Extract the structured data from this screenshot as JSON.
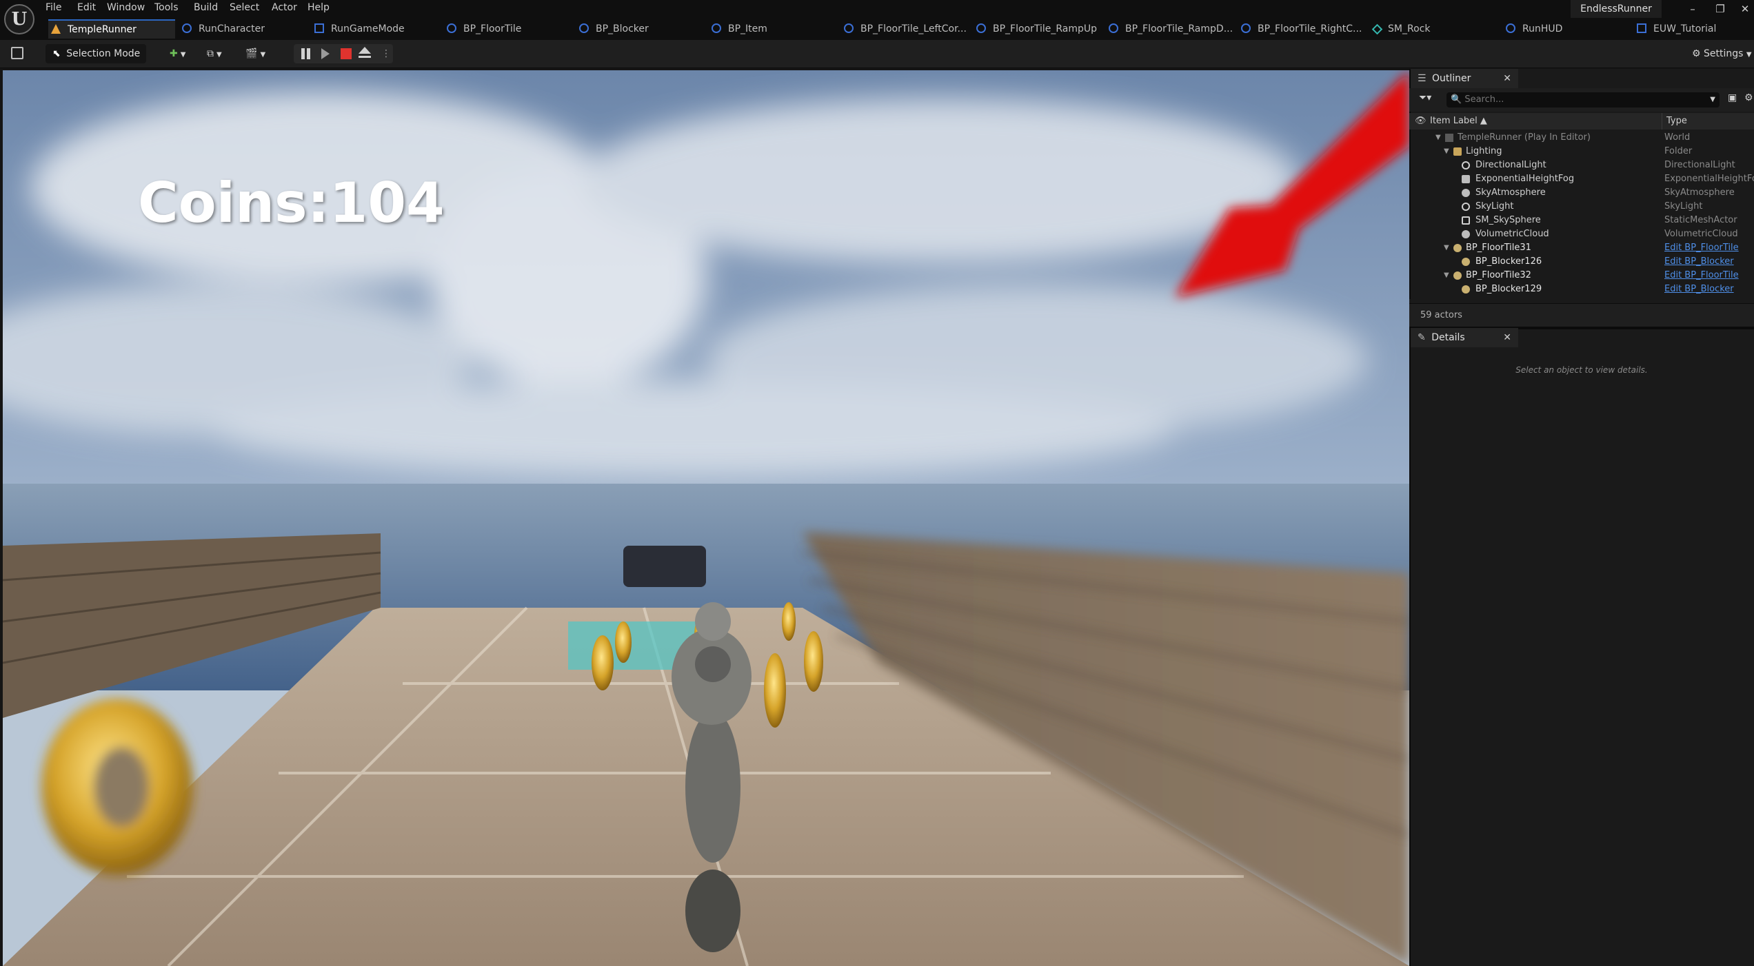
{
  "menu": [
    "File",
    "Edit",
    "Window",
    "Tools",
    "Build",
    "Select",
    "Actor",
    "Help"
  ],
  "project_name": "EndlessRunner",
  "tabs": [
    {
      "label": "TempleRunner",
      "icon": "level-icon",
      "color": "#e8a33b"
    },
    {
      "label": "RunCharacter",
      "icon": "blueprint-icon",
      "color": "#3b6fd6"
    },
    {
      "label": "RunGameMode",
      "icon": "blueprint-icon",
      "color": "#3b6fd6"
    },
    {
      "label": "BP_FloorTile",
      "icon": "blueprint-icon",
      "color": "#3b6fd6"
    },
    {
      "label": "BP_Blocker",
      "icon": "blueprint-icon",
      "color": "#3b6fd6"
    },
    {
      "label": "BP_Item",
      "icon": "blueprint-icon",
      "color": "#3b6fd6"
    },
    {
      "label": "BP_FloorTile_LeftCor...",
      "icon": "blueprint-icon",
      "color": "#3b6fd6"
    },
    {
      "label": "BP_FloorTile_RampUp",
      "icon": "blueprint-icon",
      "color": "#3b6fd6"
    },
    {
      "label": "BP_FloorTile_RampD...",
      "icon": "blueprint-icon",
      "color": "#3b6fd6"
    },
    {
      "label": "BP_FloorTile_RightC...",
      "icon": "blueprint-icon",
      "color": "#3b6fd6"
    },
    {
      "label": "SM_Rock",
      "icon": "static-mesh-icon",
      "color": "#35b8b0"
    },
    {
      "label": "RunHUD",
      "icon": "blueprint-icon",
      "color": "#3b6fd6"
    },
    {
      "label": "EUW_Tutorial",
      "icon": "widget-icon",
      "color": "#3b6fd6"
    }
  ],
  "toolbar": {
    "selection_mode": "Selection Mode",
    "settings": "Settings"
  },
  "viewport": {
    "hud_text": "Coins:104"
  },
  "outliner": {
    "tab_label": "Outliner",
    "search_placeholder": "Search...",
    "col_label": "Item Label ▲",
    "col_type": "Type",
    "rows": [
      {
        "label": "TempleRunner (Play In Editor)",
        "type": "World",
        "link": false,
        "dim": true
      },
      {
        "label": "Lighting",
        "type": "Folder",
        "link": false
      },
      {
        "label": "DirectionalLight",
        "type": "DirectionalLight",
        "link": false
      },
      {
        "label": "ExponentialHeightFog",
        "type": "ExponentialHeightFog",
        "link": false
      },
      {
        "label": "SkyAtmosphere",
        "type": "SkyAtmosphere",
        "link": false
      },
      {
        "label": "SkyLight",
        "type": "SkyLight",
        "link": false
      },
      {
        "label": "SM_SkySphere",
        "type": "StaticMeshActor",
        "link": false
      },
      {
        "label": "VolumetricCloud",
        "type": "VolumetricCloud",
        "link": false
      },
      {
        "label": "BP_FloorTile31",
        "type": "Edit BP_FloorTile",
        "link": true
      },
      {
        "label": "BP_Blocker126",
        "type": "Edit BP_Blocker",
        "link": true
      },
      {
        "label": "BP_FloorTile32",
        "type": "Edit BP_FloorTile",
        "link": true
      },
      {
        "label": "BP_Blocker129",
        "type": "Edit BP_Blocker",
        "link": true
      }
    ],
    "actor_count": "59 actors"
  },
  "details": {
    "tab_label": "Details",
    "empty_text": "Select an object to view details."
  }
}
